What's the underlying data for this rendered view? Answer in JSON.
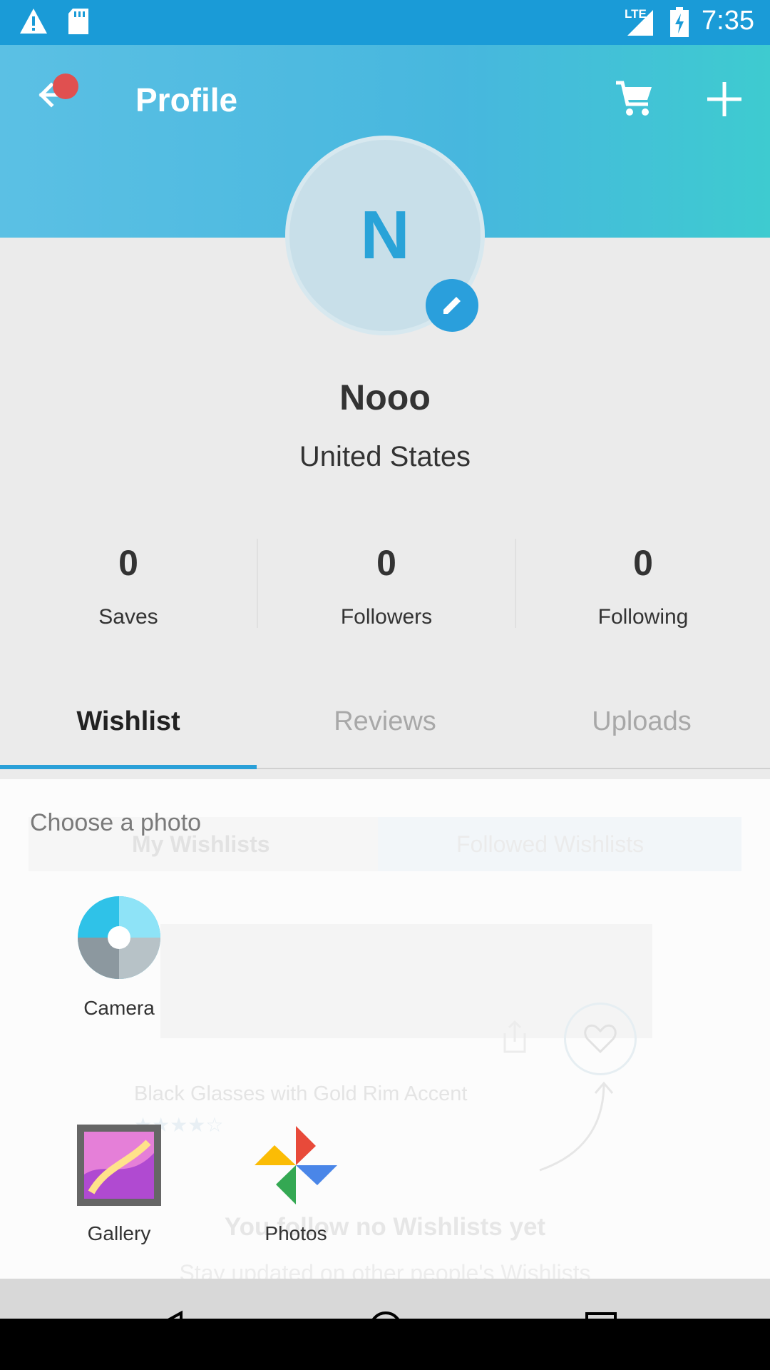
{
  "status_bar": {
    "time": "7:35",
    "network": "LTE"
  },
  "app_bar": {
    "title": "Profile"
  },
  "profile": {
    "initial": "N",
    "name": "Nooo",
    "country": "United States"
  },
  "stats": [
    {
      "value": "0",
      "label": "Saves"
    },
    {
      "value": "0",
      "label": "Followers"
    },
    {
      "value": "0",
      "label": "Following"
    }
  ],
  "tabs": [
    {
      "label": "Wishlist",
      "active": true
    },
    {
      "label": "Reviews",
      "active": false
    },
    {
      "label": "Uploads",
      "active": false
    }
  ],
  "background": {
    "subtabs": [
      "My Wishlists",
      "Followed Wishlists"
    ],
    "item_title": "Black Glasses with Gold Rim Accent",
    "empty_title": "You follow no Wishlists yet",
    "empty_subtitle": "Stay updated on other people's Wishlists"
  },
  "chooser": {
    "title": "Choose a photo",
    "apps": [
      {
        "label": "Camera",
        "icon": "camera-icon"
      },
      {
        "label": "Gallery",
        "icon": "gallery-icon"
      },
      {
        "label": "Photos",
        "icon": "photos-icon"
      }
    ]
  },
  "colors": {
    "accent": "#2aa0d8",
    "header": "#47b7de",
    "notification_dot": "#e05050"
  }
}
